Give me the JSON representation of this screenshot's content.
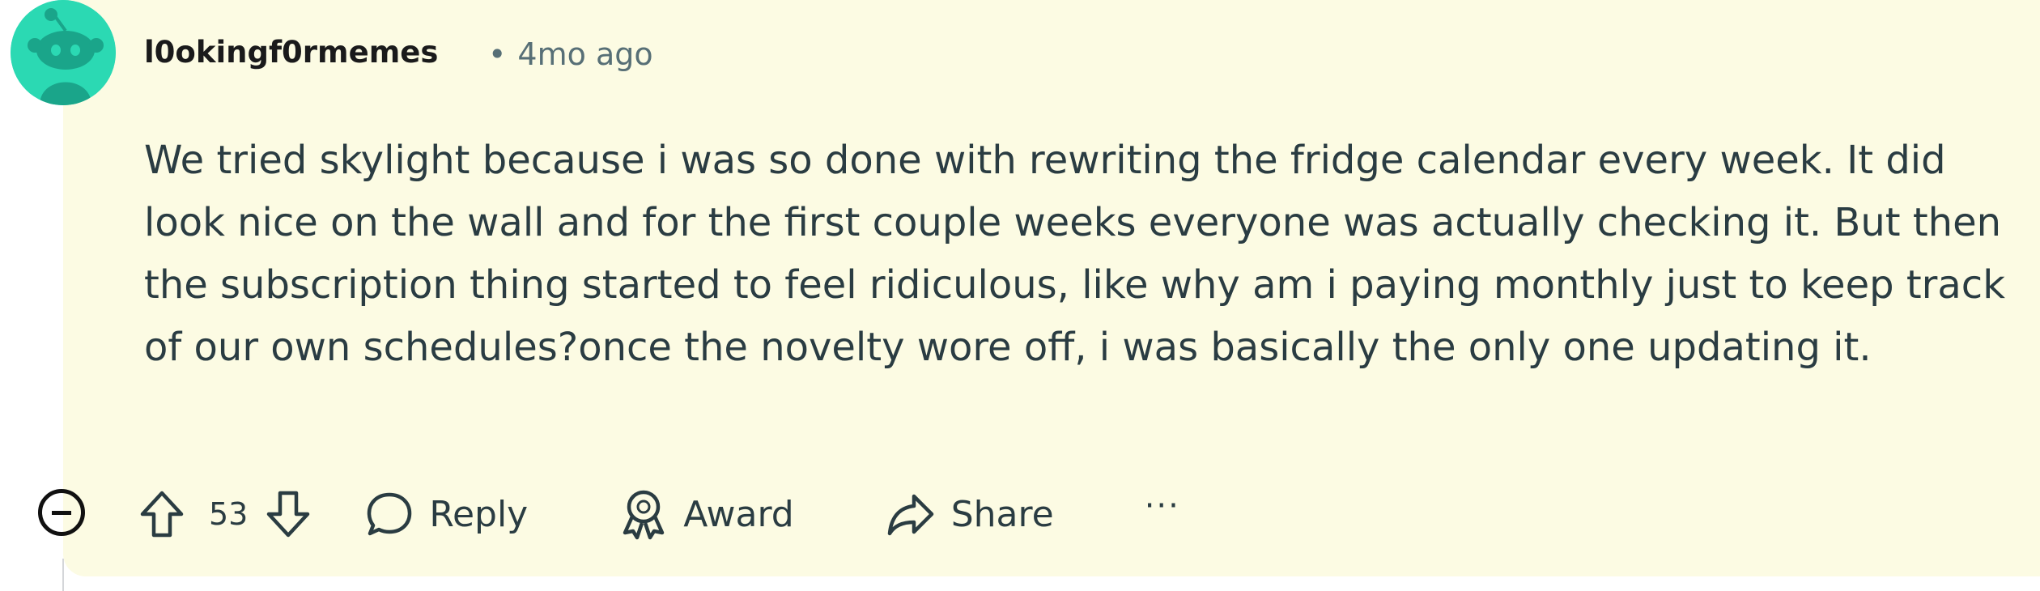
{
  "comment": {
    "author": "l0okingf0rmemes",
    "meta_separator": "•",
    "timestamp": "4mo ago",
    "body": "We tried skylight because i was so done with rewriting the fridge calendar every week. It did look nice on the wall and for the first couple weeks everyone was actually checking it. But then the subscription thing started to feel ridiculous, like why am i paying monthly just to keep track of our own schedules?once the novelty wore off, i was basically the only one updating it.",
    "vote_count": "53",
    "actions": {
      "reply": "Reply",
      "award": "Award",
      "share": "Share",
      "more": "···"
    }
  },
  "colors": {
    "card_background": "#fcfbe3",
    "avatar_background": "#2bd9b3",
    "text_primary": "#2a3c42",
    "text_meta": "#576f76"
  },
  "icons": {
    "collapse": "collapse-thread-icon",
    "upvote": "upvote-arrow-icon",
    "downvote": "downvote-arrow-icon",
    "reply": "speech-bubble-icon",
    "award": "award-ribbon-icon",
    "share": "share-arrow-icon"
  }
}
